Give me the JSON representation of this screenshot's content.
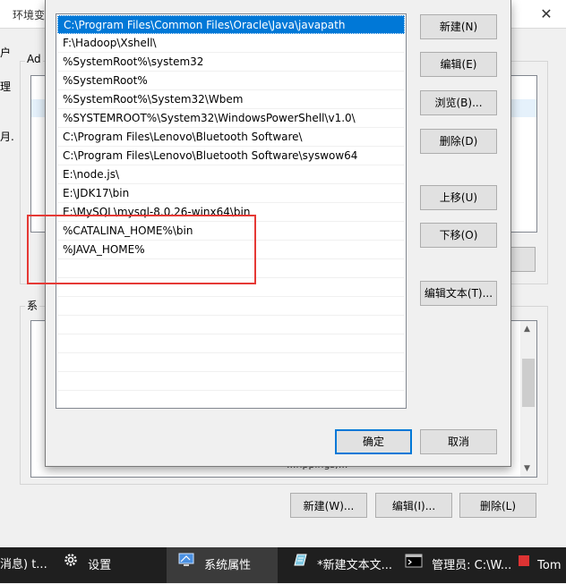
{
  "background_window": {
    "title": "环境变",
    "close_glyph": "✕",
    "frag_user": "户",
    "frag_ad": "Ad",
    "frag_manage": "理",
    "frag_month": "月.",
    "frag_system": "系",
    "frag_paren": ")",
    "frag_path_tail": "...nppings;...",
    "buttons": {
      "new": "新建(W)...",
      "edit": "编辑(I)...",
      "delete": "删除(L)"
    }
  },
  "dialog": {
    "path_entries": [
      "C:\\Program Files\\Common Files\\Oracle\\Java\\javapath",
      "F:\\Hadoop\\Xshell\\",
      "%SystemRoot%\\system32",
      "%SystemRoot%",
      "%SystemRoot%\\System32\\Wbem",
      "%SYSTEMROOT%\\System32\\WindowsPowerShell\\v1.0\\",
      "C:\\Program Files\\Lenovo\\Bluetooth Software\\",
      "C:\\Program Files\\Lenovo\\Bluetooth Software\\syswow64",
      "E:\\node.js\\",
      "E:\\JDK17\\bin",
      "E:\\MySQL\\mysql-8.0.26-winx64\\bin",
      "%CATALINA_HOME%\\bin",
      "%JAVA_HOME%"
    ],
    "selected_index": 0,
    "buttons": {
      "new": "新建(N)",
      "edit": "编辑(E)",
      "browse": "浏览(B)...",
      "delete": "删除(D)",
      "move_up": "上移(U)",
      "move_down": "下移(O)",
      "edit_text": "编辑文本(T)...",
      "ok": "确定",
      "cancel": "取消"
    },
    "highlight_color": "#e53935",
    "selection_color": "#0078d7"
  },
  "taskbar": {
    "items": [
      {
        "label": "消息) t...",
        "icon": "chat-icon"
      },
      {
        "label": "设置",
        "icon": "gear-icon"
      },
      {
        "label": "系统属性",
        "icon": "system-properties-icon",
        "active": true
      },
      {
        "label": "*新建文本文...",
        "icon": "notepad-icon"
      },
      {
        "label": "管理员: C:\\W...",
        "icon": "terminal-icon"
      },
      {
        "label": "Tom",
        "icon": "tomcat-icon"
      }
    ]
  }
}
